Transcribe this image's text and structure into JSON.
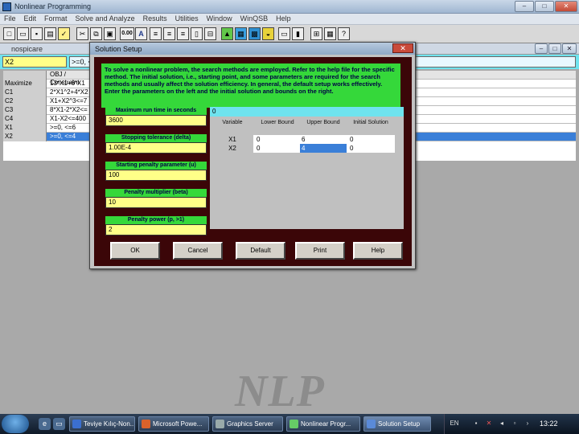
{
  "window": {
    "title": "Nonlinear Programming",
    "controls": [
      "–",
      "□",
      "✕"
    ]
  },
  "menu": [
    "File",
    "Edit",
    "Format",
    "Solve and Analyze",
    "Results",
    "Utilities",
    "Window",
    "WinQSB",
    "Help"
  ],
  "toolbar": {
    "zoom": "0.00",
    "font_icon": "A"
  },
  "document": {
    "title": "nospicare"
  },
  "cell": {
    "ref": "X2",
    "value": ">=0, <="
  },
  "grid": {
    "header": [
      "",
      "OBJ / Constraint"
    ],
    "rows": [
      [
        "Maximize",
        "13*X1+6*X1"
      ],
      [
        "C1",
        "2*X1^2+4*X2"
      ],
      [
        "C2",
        "X1+X2^3<=7"
      ],
      [
        "C3",
        "8*X1-2*X2<="
      ],
      [
        "C4",
        "X1-X2<=400"
      ],
      [
        "X1",
        ">=0, <=6"
      ],
      [
        "X2",
        ">=0, <=4"
      ]
    ]
  },
  "dialog": {
    "title": "Solution Setup",
    "close": "✕",
    "info": "To solve a nonlinear problem, the search methods are employed. Refer to the help file for the specific method. The initial solution, i.e., starting point, and some parameters are required for the search methods and usually affect the solution efficiency. In general, the default setup works effectively. Enter the parameters on the left and the initial solution and bounds on the right.",
    "params": [
      {
        "label": "Maximum run time in seconds",
        "value": "3600"
      },
      {
        "label": "Stopping tolerance (delta)",
        "value": "1.00E-4"
      },
      {
        "label": "Starting penalty parameter (u)",
        "value": "100"
      },
      {
        "label": "Penalty multiplier (beta)",
        "value": "10"
      },
      {
        "label": "Penalty power (p, >1)",
        "value": "2"
      }
    ],
    "cell_value": "0",
    "table": {
      "headers": [
        "Variable",
        "Lower Bound",
        "Upper Bound",
        "Initial Solution"
      ],
      "rows": [
        [
          "X1",
          "0",
          "6",
          "0"
        ],
        [
          "X2",
          "0",
          "4",
          "0"
        ]
      ]
    },
    "buttons": [
      "OK",
      "Cancel",
      "Default",
      "Print",
      "Help"
    ]
  },
  "watermark": "NLP",
  "taskbar": {
    "tasks": [
      "Teviye Kılıç-Non...",
      "Microsoft Powe...",
      "Graphics Server",
      "Nonlinear Progr...",
      "Solution Setup"
    ],
    "lang": "EN",
    "clock": "13:22"
  }
}
